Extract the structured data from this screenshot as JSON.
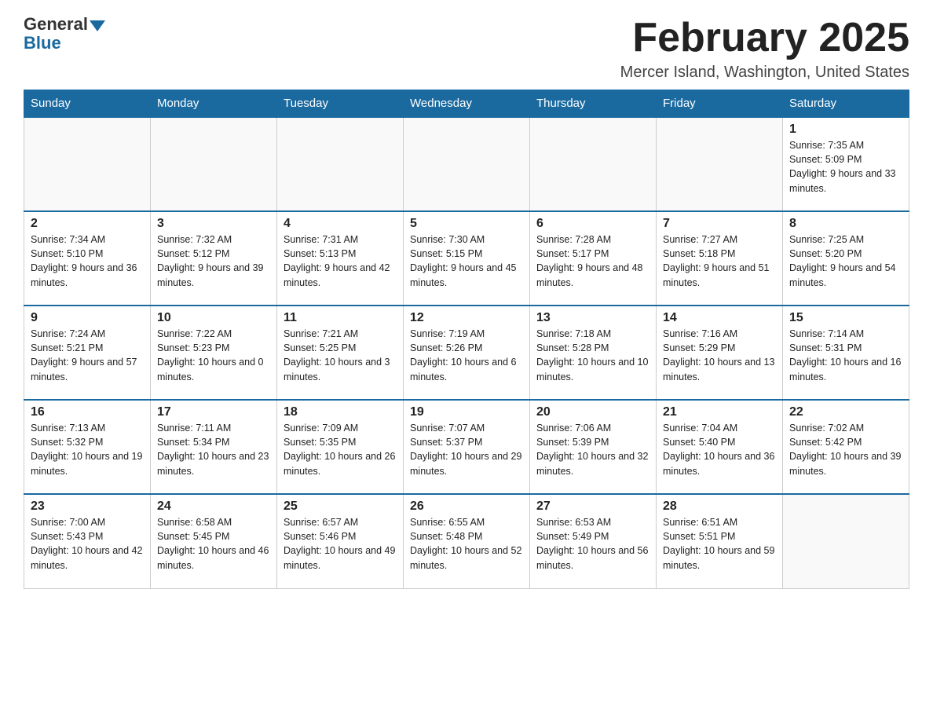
{
  "header": {
    "logo_general": "General",
    "logo_blue": "Blue",
    "month_title": "February 2025",
    "location": "Mercer Island, Washington, United States"
  },
  "days_of_week": [
    "Sunday",
    "Monday",
    "Tuesday",
    "Wednesday",
    "Thursday",
    "Friday",
    "Saturday"
  ],
  "weeks": [
    [
      {
        "day": "",
        "sunrise": "",
        "sunset": "",
        "daylight": ""
      },
      {
        "day": "",
        "sunrise": "",
        "sunset": "",
        "daylight": ""
      },
      {
        "day": "",
        "sunrise": "",
        "sunset": "",
        "daylight": ""
      },
      {
        "day": "",
        "sunrise": "",
        "sunset": "",
        "daylight": ""
      },
      {
        "day": "",
        "sunrise": "",
        "sunset": "",
        "daylight": ""
      },
      {
        "day": "",
        "sunrise": "",
        "sunset": "",
        "daylight": ""
      },
      {
        "day": "1",
        "sunrise": "Sunrise: 7:35 AM",
        "sunset": "Sunset: 5:09 PM",
        "daylight": "Daylight: 9 hours and 33 minutes."
      }
    ],
    [
      {
        "day": "2",
        "sunrise": "Sunrise: 7:34 AM",
        "sunset": "Sunset: 5:10 PM",
        "daylight": "Daylight: 9 hours and 36 minutes."
      },
      {
        "day": "3",
        "sunrise": "Sunrise: 7:32 AM",
        "sunset": "Sunset: 5:12 PM",
        "daylight": "Daylight: 9 hours and 39 minutes."
      },
      {
        "day": "4",
        "sunrise": "Sunrise: 7:31 AM",
        "sunset": "Sunset: 5:13 PM",
        "daylight": "Daylight: 9 hours and 42 minutes."
      },
      {
        "day": "5",
        "sunrise": "Sunrise: 7:30 AM",
        "sunset": "Sunset: 5:15 PM",
        "daylight": "Daylight: 9 hours and 45 minutes."
      },
      {
        "day": "6",
        "sunrise": "Sunrise: 7:28 AM",
        "sunset": "Sunset: 5:17 PM",
        "daylight": "Daylight: 9 hours and 48 minutes."
      },
      {
        "day": "7",
        "sunrise": "Sunrise: 7:27 AM",
        "sunset": "Sunset: 5:18 PM",
        "daylight": "Daylight: 9 hours and 51 minutes."
      },
      {
        "day": "8",
        "sunrise": "Sunrise: 7:25 AM",
        "sunset": "Sunset: 5:20 PM",
        "daylight": "Daylight: 9 hours and 54 minutes."
      }
    ],
    [
      {
        "day": "9",
        "sunrise": "Sunrise: 7:24 AM",
        "sunset": "Sunset: 5:21 PM",
        "daylight": "Daylight: 9 hours and 57 minutes."
      },
      {
        "day": "10",
        "sunrise": "Sunrise: 7:22 AM",
        "sunset": "Sunset: 5:23 PM",
        "daylight": "Daylight: 10 hours and 0 minutes."
      },
      {
        "day": "11",
        "sunrise": "Sunrise: 7:21 AM",
        "sunset": "Sunset: 5:25 PM",
        "daylight": "Daylight: 10 hours and 3 minutes."
      },
      {
        "day": "12",
        "sunrise": "Sunrise: 7:19 AM",
        "sunset": "Sunset: 5:26 PM",
        "daylight": "Daylight: 10 hours and 6 minutes."
      },
      {
        "day": "13",
        "sunrise": "Sunrise: 7:18 AM",
        "sunset": "Sunset: 5:28 PM",
        "daylight": "Daylight: 10 hours and 10 minutes."
      },
      {
        "day": "14",
        "sunrise": "Sunrise: 7:16 AM",
        "sunset": "Sunset: 5:29 PM",
        "daylight": "Daylight: 10 hours and 13 minutes."
      },
      {
        "day": "15",
        "sunrise": "Sunrise: 7:14 AM",
        "sunset": "Sunset: 5:31 PM",
        "daylight": "Daylight: 10 hours and 16 minutes."
      }
    ],
    [
      {
        "day": "16",
        "sunrise": "Sunrise: 7:13 AM",
        "sunset": "Sunset: 5:32 PM",
        "daylight": "Daylight: 10 hours and 19 minutes."
      },
      {
        "day": "17",
        "sunrise": "Sunrise: 7:11 AM",
        "sunset": "Sunset: 5:34 PM",
        "daylight": "Daylight: 10 hours and 23 minutes."
      },
      {
        "day": "18",
        "sunrise": "Sunrise: 7:09 AM",
        "sunset": "Sunset: 5:35 PM",
        "daylight": "Daylight: 10 hours and 26 minutes."
      },
      {
        "day": "19",
        "sunrise": "Sunrise: 7:07 AM",
        "sunset": "Sunset: 5:37 PM",
        "daylight": "Daylight: 10 hours and 29 minutes."
      },
      {
        "day": "20",
        "sunrise": "Sunrise: 7:06 AM",
        "sunset": "Sunset: 5:39 PM",
        "daylight": "Daylight: 10 hours and 32 minutes."
      },
      {
        "day": "21",
        "sunrise": "Sunrise: 7:04 AM",
        "sunset": "Sunset: 5:40 PM",
        "daylight": "Daylight: 10 hours and 36 minutes."
      },
      {
        "day": "22",
        "sunrise": "Sunrise: 7:02 AM",
        "sunset": "Sunset: 5:42 PM",
        "daylight": "Daylight: 10 hours and 39 minutes."
      }
    ],
    [
      {
        "day": "23",
        "sunrise": "Sunrise: 7:00 AM",
        "sunset": "Sunset: 5:43 PM",
        "daylight": "Daylight: 10 hours and 42 minutes."
      },
      {
        "day": "24",
        "sunrise": "Sunrise: 6:58 AM",
        "sunset": "Sunset: 5:45 PM",
        "daylight": "Daylight: 10 hours and 46 minutes."
      },
      {
        "day": "25",
        "sunrise": "Sunrise: 6:57 AM",
        "sunset": "Sunset: 5:46 PM",
        "daylight": "Daylight: 10 hours and 49 minutes."
      },
      {
        "day": "26",
        "sunrise": "Sunrise: 6:55 AM",
        "sunset": "Sunset: 5:48 PM",
        "daylight": "Daylight: 10 hours and 52 minutes."
      },
      {
        "day": "27",
        "sunrise": "Sunrise: 6:53 AM",
        "sunset": "Sunset: 5:49 PM",
        "daylight": "Daylight: 10 hours and 56 minutes."
      },
      {
        "day": "28",
        "sunrise": "Sunrise: 6:51 AM",
        "sunset": "Sunset: 5:51 PM",
        "daylight": "Daylight: 10 hours and 59 minutes."
      },
      {
        "day": "",
        "sunrise": "",
        "sunset": "",
        "daylight": ""
      }
    ]
  ]
}
